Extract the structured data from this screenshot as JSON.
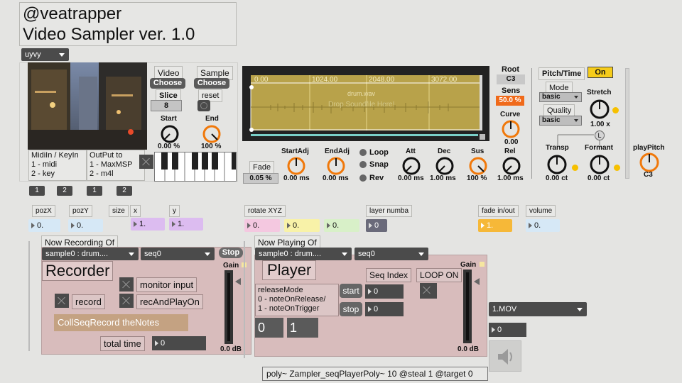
{
  "title": {
    "line1": "@veatrapper",
    "line2": "Video Sampler ver. 1.0"
  },
  "video": {
    "format_menu": "uyvy",
    "midi_options": [
      "MidiIn / KeyIn",
      "1 - midi",
      "2 - key"
    ],
    "output_options": [
      "OutPut to",
      "1 - MaxMSP",
      "2 - m4l"
    ],
    "buttons": [
      "1",
      "2",
      "1",
      "2"
    ],
    "video_label": "Video",
    "sample_label": "Sample",
    "choose_label": "Choose",
    "choose_label2": "Choose",
    "slice_label": "Slice",
    "slice_value": "8",
    "reset_label": "reset",
    "start_label": "Start",
    "start_value": "0.00 %",
    "end_label": "End",
    "end_value": "100 %"
  },
  "waveform": {
    "ruler": [
      "0.00",
      "1024.00",
      "2048.00",
      "3072.00"
    ],
    "filename": "drum.wav",
    "drop_hint": "Drop Soundfile Here!"
  },
  "envelope": {
    "root_label": "Root",
    "root_value": "C3",
    "sens_label": "Sens",
    "sens_value": "50.0 %",
    "curve_label": "Curve",
    "curve_value": "0.00",
    "fade_label": "Fade",
    "fade_value": "0.05 %",
    "startadj_label": "StartAdj",
    "startadj_value": "0.00 ms",
    "endadj_label": "EndAdj",
    "endadj_value": "0.00 ms",
    "loop_label": "Loop",
    "snap_label": "Snap",
    "rev_label": "Rev",
    "att_label": "Att",
    "att_value": "0.00 ms",
    "dec_label": "Dec",
    "dec_value": "1.00 ms",
    "sus_label": "Sus",
    "sus_value": "100 %",
    "rel_label": "Rel",
    "rel_value": "1.00 ms"
  },
  "pitch": {
    "header": "Pitch/Time",
    "on_label": "On",
    "mode_label": "Mode",
    "mode_value": "basic",
    "quality_label": "Quality",
    "quality_value": "basic",
    "stretch_label": "Stretch",
    "stretch_value": "1.00 x",
    "link_label": "L",
    "transp_label": "Transp",
    "transp_value": "0.00 ct",
    "formant_label": "Formant",
    "formant_value": "0.00 ct",
    "playpitch_label": "playPitch",
    "playpitch_value": "C3"
  },
  "params": {
    "pozx_label": "pozX",
    "pozx_value": "0.",
    "pozy_label": "pozY",
    "pozy_value": "0.",
    "size_label": "size",
    "x_label": "x",
    "x_value": "1.",
    "y_label": "y",
    "y_value": "1.",
    "rotate_label": "rotate XYZ",
    "rot1": "0.",
    "rot2": "0.",
    "rot3": "0.",
    "layer_label": "layer numba",
    "layer_value": "0",
    "fade_label": "fade in/out",
    "fade_value": "1.",
    "volume_label": "volume",
    "volume_value": "0."
  },
  "recorder": {
    "header": "Now Recording Of",
    "sample_menu": "sample0 : drum....",
    "seq_menu": "seq0",
    "stop_label": "Stop",
    "title": "Recorder",
    "gain_label": "Gain",
    "monitor_label": "monitor input",
    "record_label": "record",
    "recplay_label": "recAndPlayOn",
    "collseq_label": "CollSeqRecord theNotes",
    "total_label": "total time",
    "total_value": "0",
    "gain_value": "0.0 dB"
  },
  "player": {
    "header": "Now Playing Of",
    "sample_menu": "sample0 : drum....",
    "seq_menu": "seq0",
    "title": "Player",
    "seq_index_label": "Seq Index",
    "loop_on_label": "LOOP ON",
    "gain_label": "Gain",
    "release_lines": [
      "releaseMode",
      "0 - noteOnRelease/",
      "1 - noteOnTrigger"
    ],
    "start_label": "start",
    "start_value": "0",
    "stop_label": "stop",
    "stop_value": "0",
    "msg0": "0",
    "msg1": "1",
    "gain_value": "0.0 dB"
  },
  "movie": {
    "menu": "1.MOV",
    "number": "0"
  },
  "poly": "poly~ Zampler_seqPlayerPoly~ 10 @steal 1 @target 0",
  "colors": {
    "waveform_bg": "#b8a24a",
    "orange": "#f0780a",
    "panel": "#d8bcbc",
    "on_yellow": "#f6cc1a",
    "lilac": "#dcbcf0",
    "pink": "#f4c8e0",
    "lemon": "#f8f2a8",
    "mint": "#d8f0c8",
    "lightblue": "#d6e8f6",
    "amber": "#f6b838"
  }
}
